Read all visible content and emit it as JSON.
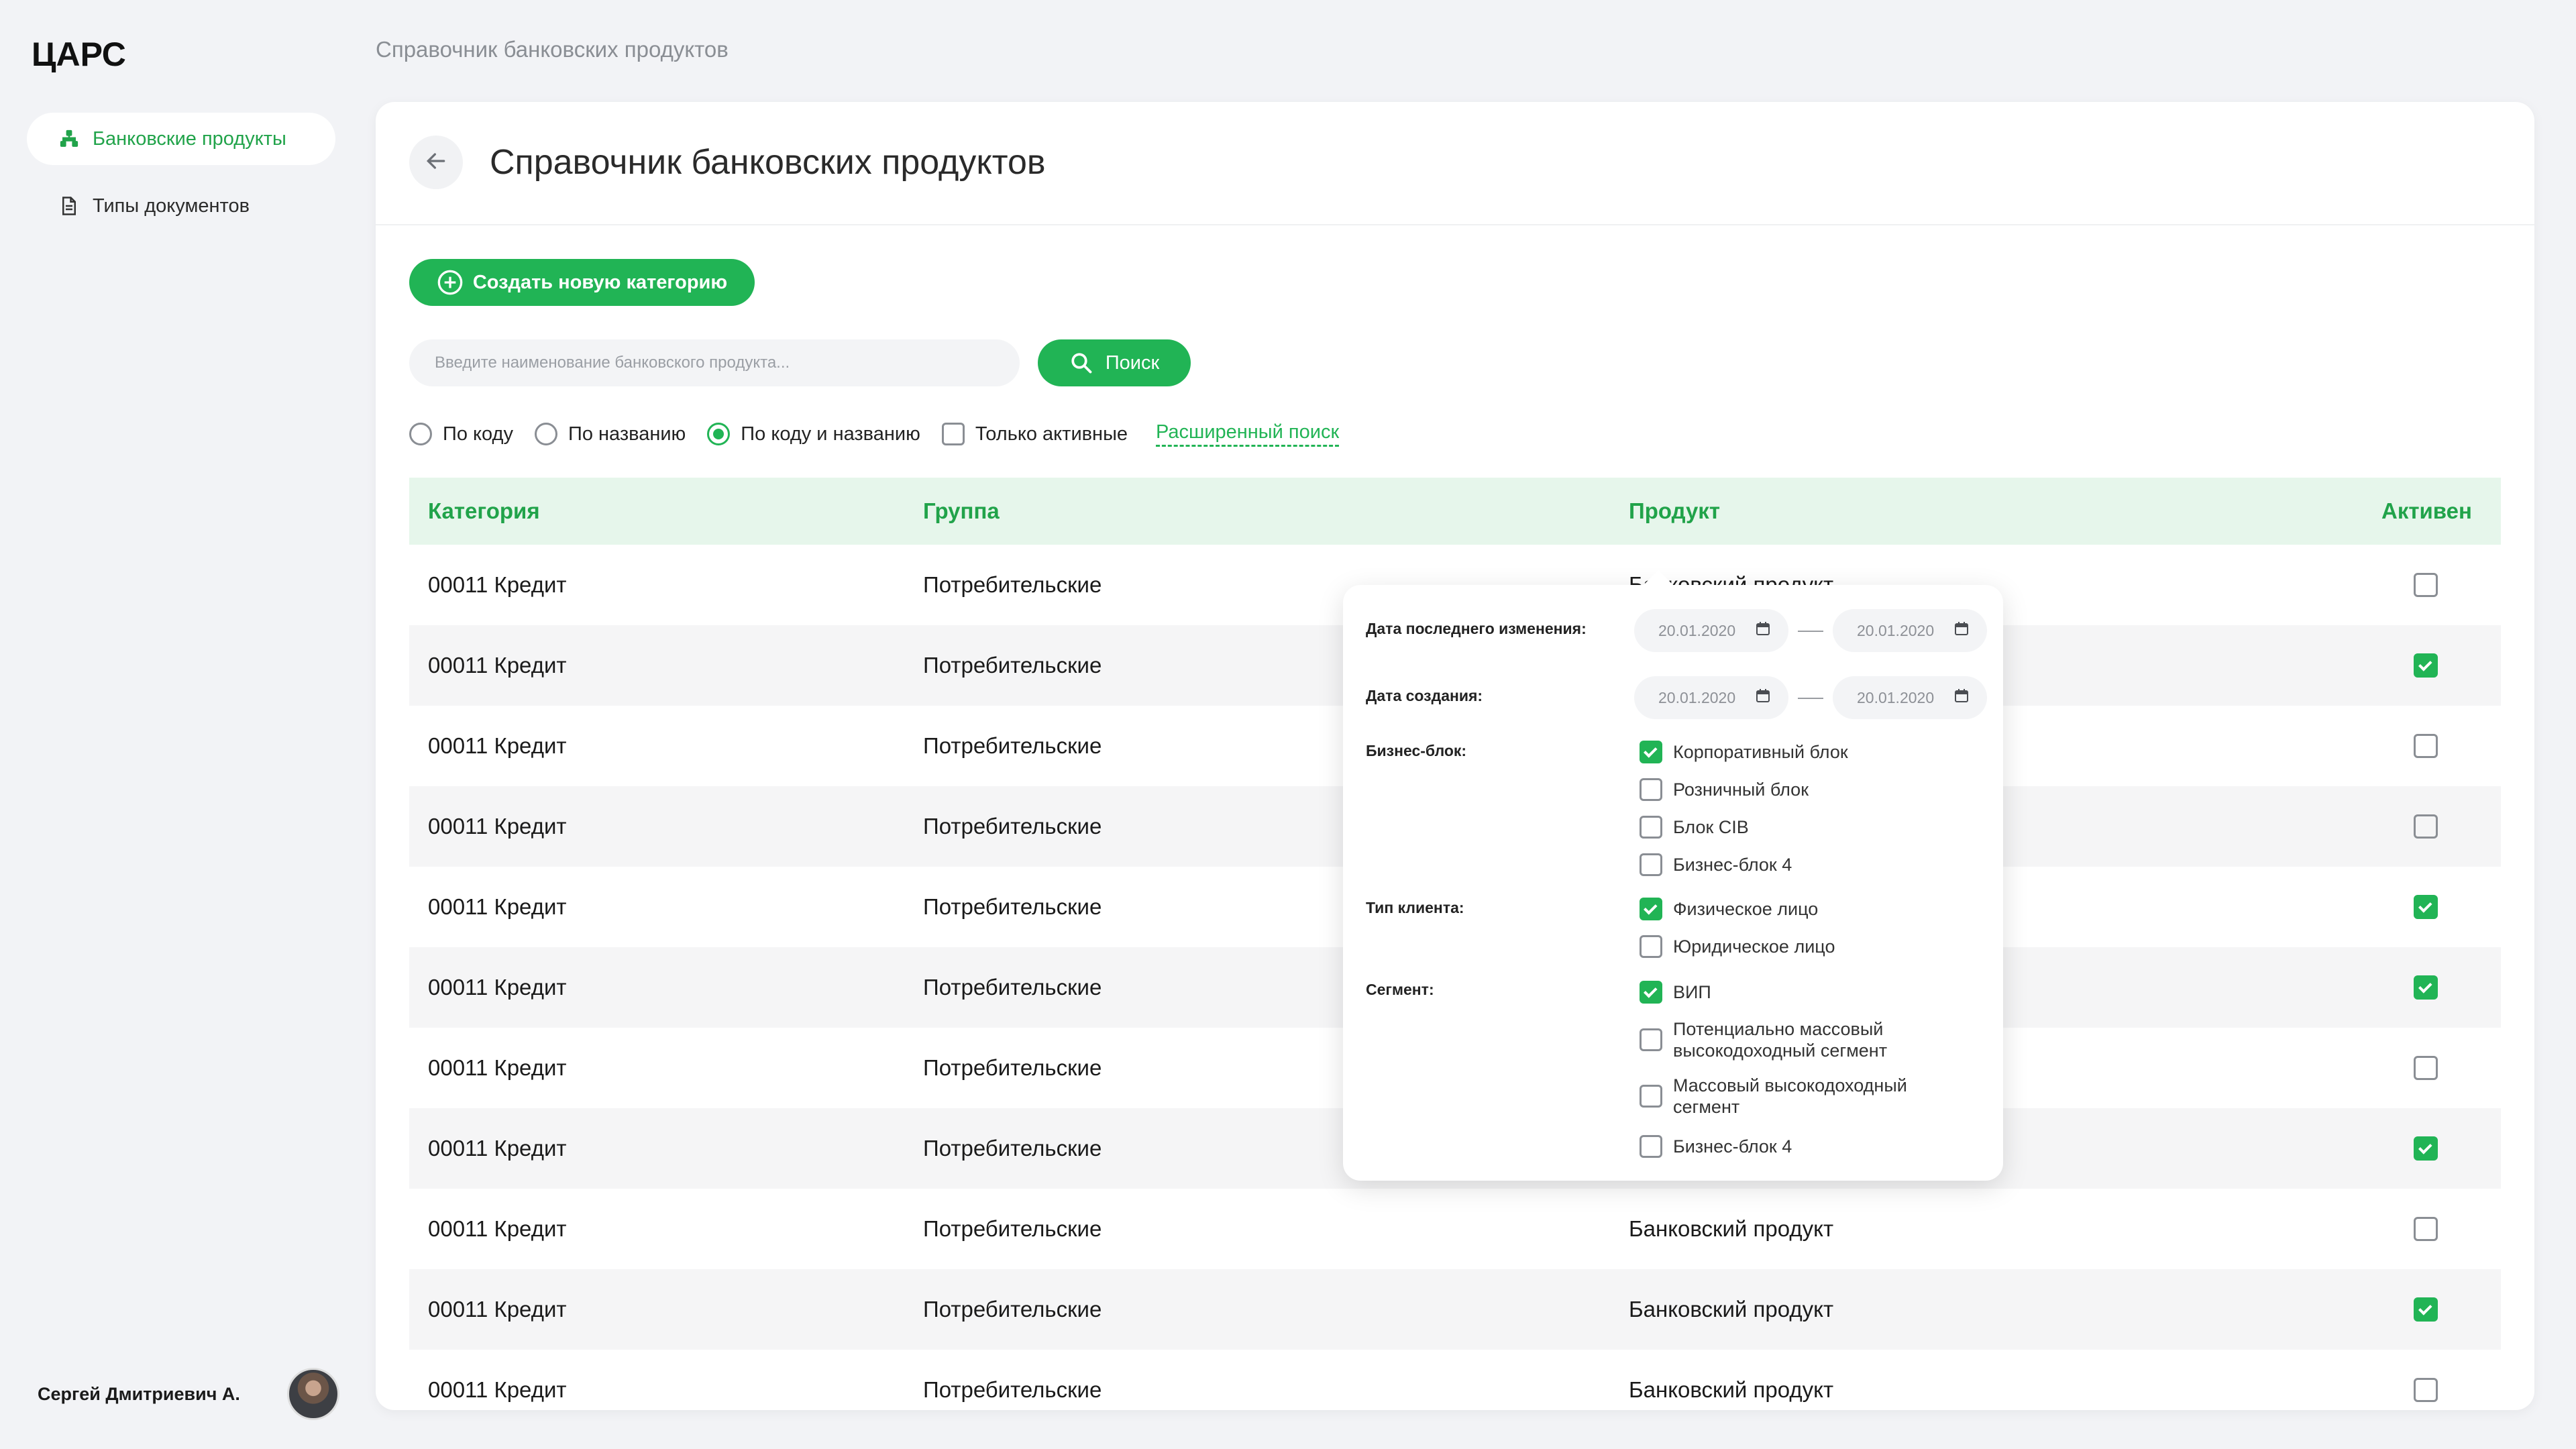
{
  "app": {
    "logo": "ЦАРС"
  },
  "sidebar": {
    "items": [
      {
        "label": "Банковские продукты",
        "icon": "hierarchy-icon",
        "active": true
      },
      {
        "label": "Типы документов",
        "icon": "document-icon",
        "active": false
      }
    ],
    "user_name": "Сергей Дмитриевич А."
  },
  "breadcrumb": "Справочник банковских продуктов",
  "page": {
    "title": "Справочник банковских продуктов",
    "create_button": "Создать новую категорию",
    "search_placeholder": "Введите наименование банковского продукта...",
    "search_value": "",
    "search_button": "Поиск",
    "filters": {
      "by_code": "По коду",
      "by_name": "По названию",
      "by_code_and_name": "По коду и названию",
      "selected": "by_code_and_name",
      "only_active": "Только активные",
      "only_active_checked": false,
      "advanced": "Расширенный поиск"
    }
  },
  "table": {
    "headers": {
      "category": "Категория",
      "group": "Группа",
      "product": "Продукт",
      "active": "Активен"
    },
    "rows": [
      {
        "category": "00011 Кредит",
        "group": "Потребительские",
        "product": "Банковский продукт",
        "active": false
      },
      {
        "category": "00011 Кредит",
        "group": "Потребительские",
        "product": "Банковский продукт",
        "active": true
      },
      {
        "category": "00011 Кредит",
        "group": "Потребительские",
        "product": "Банковский продукт",
        "active": false
      },
      {
        "category": "00011 Кредит",
        "group": "Потребительские",
        "product": "Банковский продукт",
        "active": false
      },
      {
        "category": "00011 Кредит",
        "group": "Потребительские",
        "product": "Банковский продукт",
        "active": true
      },
      {
        "category": "00011 Кредит",
        "group": "Потребительские",
        "product": "Банковский продукт",
        "active": true
      },
      {
        "category": "00011 Кредит",
        "group": "Потребительские",
        "product": "Банковский продукт",
        "active": false
      },
      {
        "category": "00011 Кредит",
        "group": "Потребительские",
        "product": "Банковский продукт",
        "active": true
      },
      {
        "category": "00011 Кредит",
        "group": "Потребительские",
        "product": "Банковский продукт",
        "active": false
      },
      {
        "category": "00011 Кредит",
        "group": "Потребительские",
        "product": "Банковский продукт",
        "active": true
      },
      {
        "category": "00011 Кредит",
        "group": "Потребительские",
        "product": "Банковский продукт",
        "active": false
      }
    ]
  },
  "advanced_search": {
    "last_modified_label": "Дата последнего изменения:",
    "last_modified_from": "20.01.2020",
    "last_modified_to": "20.01.2020",
    "created_label": "Дата создания:",
    "created_from": "20.01.2020",
    "created_to": "20.01.2020",
    "business_block_label": "Бизнес-блок:",
    "business_blocks": [
      {
        "label": "Корпоративный блок",
        "checked": true
      },
      {
        "label": "Розничный блок",
        "checked": false
      },
      {
        "label": "Блок CIB",
        "checked": false
      },
      {
        "label": "Бизнес-блок 4",
        "checked": false
      }
    ],
    "client_type_label": "Тип клиента:",
    "client_types": [
      {
        "label": "Физическое лицо",
        "checked": true
      },
      {
        "label": "Юридическое лицо",
        "checked": false
      }
    ],
    "segment_label": "Сегмент:",
    "segments": [
      {
        "label": "ВИП",
        "checked": true
      },
      {
        "label": "Потенциально массовый высокодоходный сегмент",
        "checked": false
      },
      {
        "label": "Массовый высокодоходный сегмент",
        "checked": false
      },
      {
        "label": "Бизнес-блок 4",
        "checked": false
      }
    ]
  },
  "colors": {
    "accent": "#21b455",
    "accent_dark": "#21a34a",
    "header_bg": "#e6f6eb"
  }
}
